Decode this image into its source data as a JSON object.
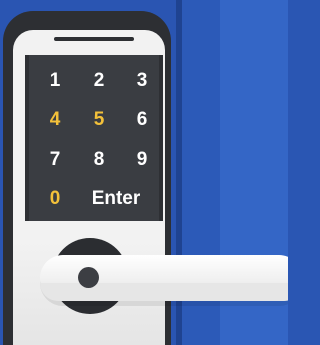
{
  "keypad": {
    "keys": [
      {
        "label": "1",
        "lit": false
      },
      {
        "label": "2",
        "lit": false
      },
      {
        "label": "3",
        "lit": false
      },
      {
        "label": "4",
        "lit": true
      },
      {
        "label": "5",
        "lit": true
      },
      {
        "label": "6",
        "lit": false
      },
      {
        "label": "7",
        "lit": false
      },
      {
        "label": "8",
        "lit": false
      },
      {
        "label": "9",
        "lit": false
      },
      {
        "label": "0",
        "lit": true
      },
      {
        "label": "Enter",
        "lit": false
      }
    ]
  },
  "colors": {
    "door_blue": "#2a55b2",
    "door_blue_light": "#3466c6",
    "lock_body": "#2d2f33",
    "keypad_bg": "#3a3d42",
    "key_text": "#ffffff",
    "key_highlight": "#f3c13a",
    "handle": "#f0f0f0"
  },
  "icons": {
    "handle_pivot": "circle"
  }
}
